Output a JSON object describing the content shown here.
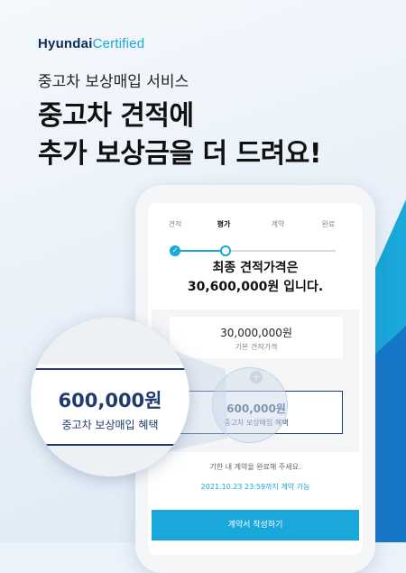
{
  "logo": {
    "part1": "Hyundai",
    "part2": "Certified"
  },
  "header": {
    "subtitle": "중고차 보상매입 서비스",
    "headline_line1": "중고차 견적에",
    "headline_line2": "추가 보상금을 더 드려요!"
  },
  "steps": [
    {
      "label": "견적",
      "state": "done"
    },
    {
      "label": "평가",
      "state": "current"
    },
    {
      "label": "계약",
      "state": "pending"
    },
    {
      "label": "완료",
      "state": "pending"
    }
  ],
  "step_icons": {
    "done": "check-icon"
  },
  "quote": {
    "line1": "최종 견적가격은",
    "line2": "30,600,000원 입니다.",
    "base_price": "30,000,000원",
    "base_label": "기본 견적가격",
    "plus": "+",
    "bonus_price": "600,000원",
    "bonus_label": "중고차 보상매입 혜택"
  },
  "notice": "기한 내 계약을 완료해 주세요.",
  "deadline": "2021.10.23 23:59까지 계약 가능",
  "cta_label": "계약서 작성하기",
  "magnifier": {
    "price": "600,000원",
    "label": "중고차 보상매입 혜택"
  },
  "colors": {
    "accent": "#1aa7d9",
    "brand_navy": "#1f3b70",
    "triangle_dark": "#1677c9"
  }
}
